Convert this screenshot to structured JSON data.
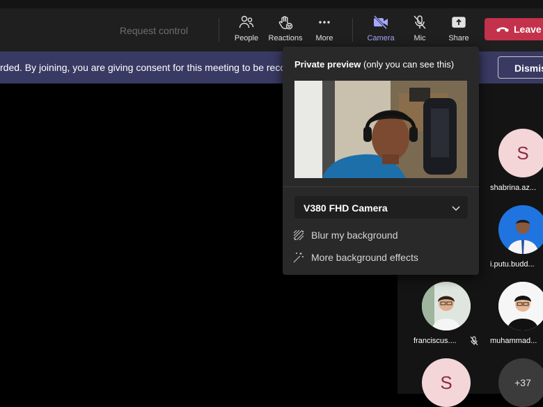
{
  "toolbar": {
    "request_control": "Request control",
    "people": "People",
    "reactions": "Reactions",
    "more": "More",
    "camera": "Camera",
    "mic": "Mic",
    "share": "Share",
    "leave": "Leave"
  },
  "banner": {
    "text": "rded. By joining, you are giving consent for this meeting to be recorded.",
    "dismiss": "Dismiss"
  },
  "preview_popup": {
    "title_bold": "Private preview",
    "title_rest": " (only you can see this)",
    "camera_device": "V380 FHD Camera",
    "blur_option": "Blur my background",
    "effects_option": "More background effects"
  },
  "participants": [
    {
      "name": "shabrina.az...",
      "initial": "S"
    },
    {
      "name": "i.putu.budd..."
    },
    {
      "name": "franciscus...."
    },
    {
      "name": "muhammad..."
    },
    {
      "name": "",
      "initial": "S"
    },
    {
      "name": "",
      "overflow": "+37"
    }
  ],
  "colors": {
    "toolbar_bg": "#1f1f1f",
    "banner_bg": "#393a63",
    "leave_red": "#c4314b",
    "accent": "#a5a8ff",
    "popup_bg": "#292929"
  }
}
